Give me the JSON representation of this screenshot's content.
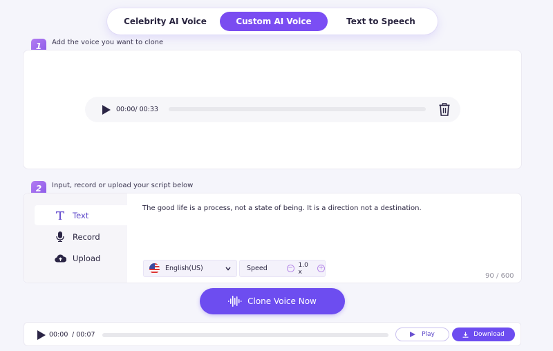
{
  "tabs": [
    {
      "label": "Celebrity AI Voice",
      "active": false
    },
    {
      "label": "Custom AI Voice",
      "active": true
    },
    {
      "label": "Text to Speech",
      "active": false
    }
  ],
  "step1": {
    "number": "1",
    "title": "Add the voice you want to clone",
    "player": {
      "current": "00:00",
      "duration": "00:33",
      "time_label": "00:00/ 00:33",
      "progress": 0
    },
    "delete_icon": "trash-icon"
  },
  "step2": {
    "number": "2",
    "title": "Input, record or upload your script below",
    "modes": [
      {
        "label": "Text",
        "icon": "text-icon",
        "active": true
      },
      {
        "label": "Record",
        "icon": "microphone-icon",
        "active": false
      },
      {
        "label": "Upload",
        "icon": "cloud-upload-icon",
        "active": false
      }
    ],
    "script": "The good life is a process, not a state of being. It is a direction not a destination.",
    "language": "English(US)",
    "speed_label": "Speed",
    "speed_value": "1.0 x",
    "char_count": "90 / 600"
  },
  "clone_button": "Clone Voice Now",
  "result_player": {
    "current": "00:00",
    "separator": "/ 00:07",
    "progress": 0,
    "play_label": "Play",
    "download_label": "Download"
  },
  "colors": {
    "accent": "#6d4df0",
    "badge": "#9b6aee",
    "background": "#f5f5fb"
  }
}
